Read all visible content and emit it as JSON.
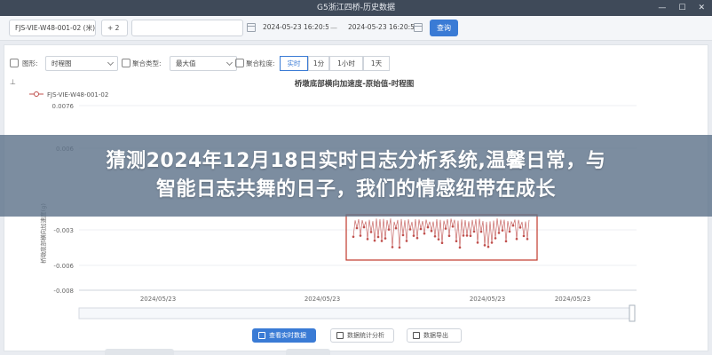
{
  "window": {
    "title": "G5浙江四桥-历史数据"
  },
  "filters": {
    "tags": [
      "FJS-VIE-W48-001-02 (米)",
      "+ 2"
    ],
    "start_time": "2024-05-23 16:20:55",
    "range_separator": "—",
    "end_time": "2024-05-23 16:20:55",
    "query_label": "查询"
  },
  "toolbar": {
    "chart_type_label": "图形:",
    "chart_type_value": "时程图",
    "agg_type_label": "聚合类型:",
    "agg_type_value": "最大值",
    "granularity_label": "聚合粒度:",
    "granularity_options": [
      "实时",
      "1分",
      "1小时",
      "1天"
    ]
  },
  "chart_data": {
    "type": "line",
    "title": "桥墩底部横向加速度-原始值-时程图",
    "ylabel": "桥墩底部横向加速度(g)",
    "ylim": [
      -0.008,
      0.0076
    ],
    "y_ticks": [
      "0.0076",
      "0.006",
      "-0.003",
      "-0.006",
      "-0.008"
    ],
    "x_ticks": [
      "2024/05/23",
      "2024/05/23",
      "2024/05/23",
      "2024/05/23"
    ],
    "y_axis_top": "⊥",
    "series": [
      {
        "name": "FJS-VIE-W48-001-02",
        "color": "#c0504d"
      }
    ],
    "grid": true,
    "legend": "top-left"
  },
  "banner": {
    "line1": "猜测2024年12月18日实时日志分析系统,温馨日常，与",
    "line2": "智能日志共舞的日子，我们的情感纽带在成长"
  },
  "buttons": {
    "realtime": "查看实时数据",
    "stats": "数据统计分析",
    "export": "数据导出"
  },
  "colors": {
    "accent": "#3a7bd5",
    "series": "#c0504d",
    "highlight_box": "#c0392b"
  }
}
